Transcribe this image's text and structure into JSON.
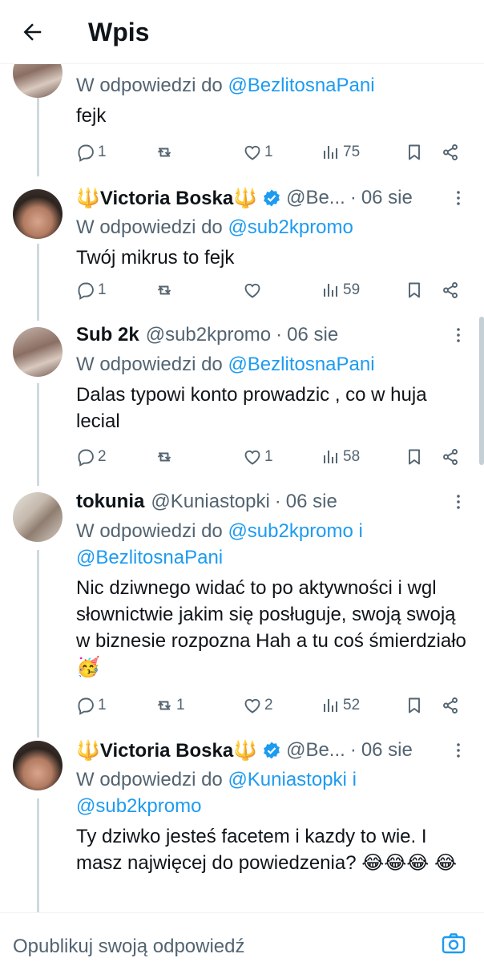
{
  "header": {
    "title": "Wpis"
  },
  "reply_prefix": "W odpowiedzi do",
  "tweets": [
    {
      "name": "",
      "handle": "",
      "date": "",
      "reply_to": [
        "@BezlitosnaPani"
      ],
      "reply_joiner": "",
      "text": "fejk",
      "stats": {
        "replies": "1",
        "retweets": "",
        "likes": "1",
        "views": "75"
      }
    },
    {
      "name": "🔱Victoria Boska🔱",
      "handle": "@Be...",
      "date": "06 sie",
      "reply_to": [
        "@sub2kpromo"
      ],
      "reply_joiner": "",
      "text": "Twój mikrus to fejk",
      "stats": {
        "replies": "1",
        "retweets": "",
        "likes": "",
        "views": "59"
      }
    },
    {
      "name": "Sub 2k",
      "handle": "@sub2kpromo",
      "date": "06 sie",
      "reply_to": [
        "@BezlitosnaPani"
      ],
      "reply_joiner": "",
      "text": "Dalas typowi konto prowadzic , co w huja lecial",
      "stats": {
        "replies": "2",
        "retweets": "",
        "likes": "1",
        "views": "58"
      }
    },
    {
      "name": "tokunia",
      "handle": "@Kuniastopki",
      "date": "06 sie",
      "reply_to": [
        "@sub2kpromo",
        "@BezlitosnaPani"
      ],
      "reply_joiner": "i",
      "text": "Nic dziwnego widać to po aktywności i wgl słownictwie jakim się posługuje, swoją swoją w biznesie rozpozna Hah a tu coś śmierdziało 🥳",
      "stats": {
        "replies": "1",
        "retweets": "1",
        "likes": "2",
        "views": "52"
      }
    },
    {
      "name": "🔱Victoria Boska🔱",
      "handle": "@Be...",
      "date": "06 sie",
      "reply_to": [
        "@Kuniastopki",
        "@sub2kpromo"
      ],
      "reply_joiner": "i",
      "text": "Ty dziwko jesteś facetem i kazdy to wie. I masz najwięcej do powiedzenia? 😂😂😂 😂",
      "stats": {
        "replies": "",
        "retweets": "",
        "likes": "",
        "views": ""
      }
    }
  ],
  "reply_bar": {
    "placeholder": "Opublikuj swoją odpowiedź"
  },
  "colors": {
    "link": "#1d9bf0",
    "muted": "#536471",
    "text": "#0f1419",
    "verified": "#1d9bf0"
  }
}
